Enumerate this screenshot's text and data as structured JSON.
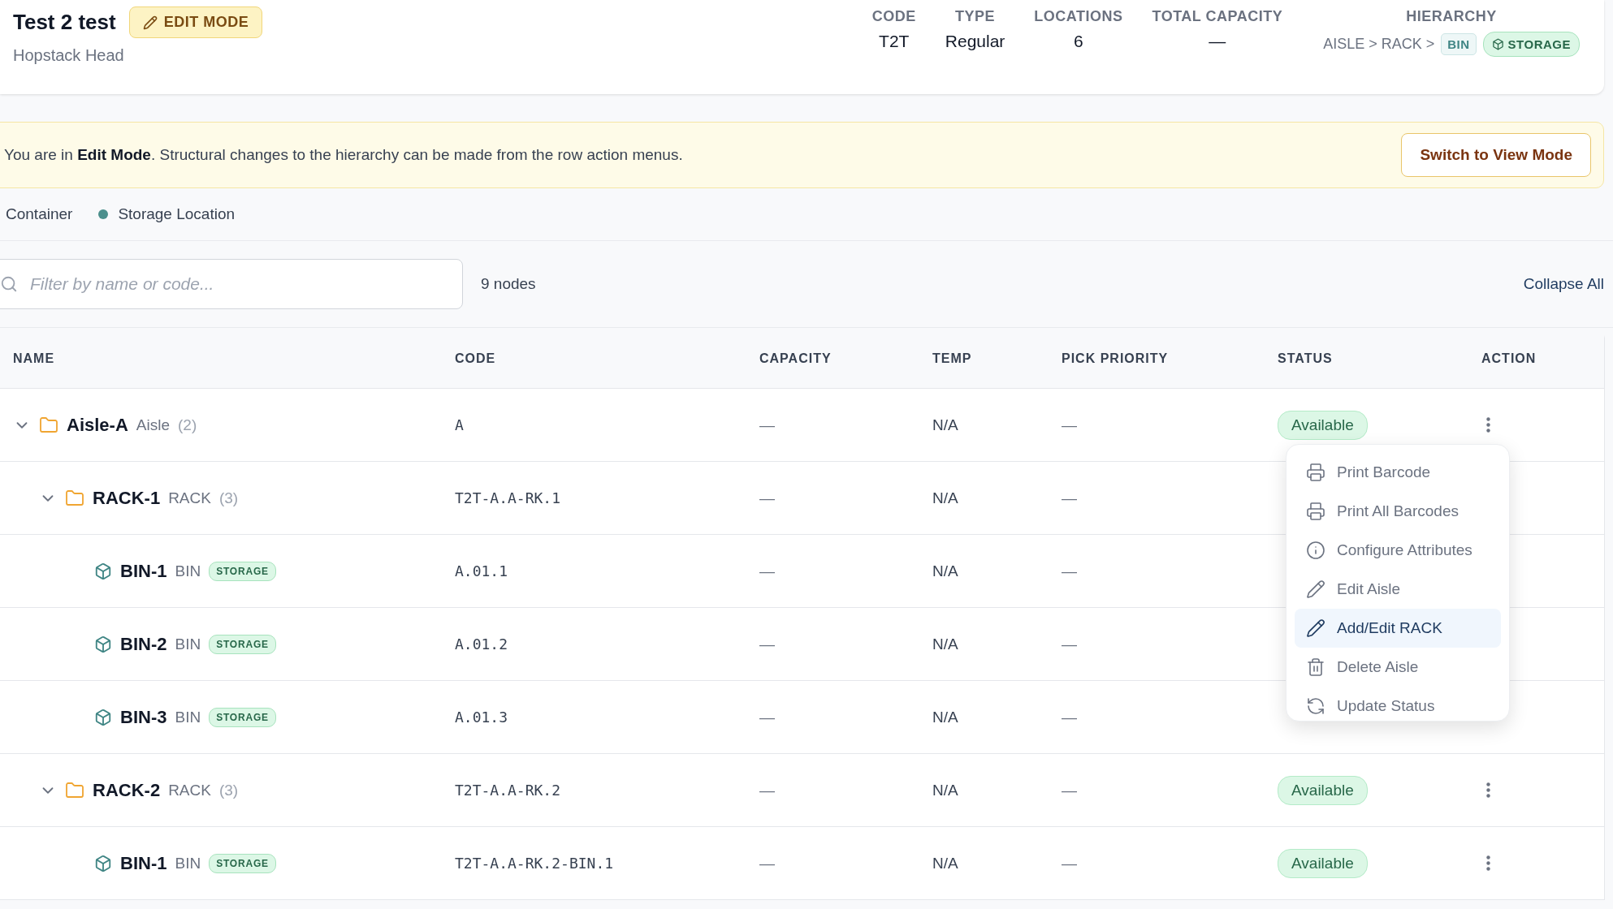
{
  "header": {
    "title": "Test 2 test",
    "mode_badge": "EDIT MODE",
    "subtitle": "Hopstack Head",
    "stats": [
      {
        "label": "CODE",
        "value": "T2T"
      },
      {
        "label": "TYPE",
        "value": "Regular"
      },
      {
        "label": "LOCATIONS",
        "value": "6"
      },
      {
        "label": "TOTAL CAPACITY",
        "value": "—"
      }
    ],
    "hierarchy": {
      "label": "HIERARCHY",
      "path": "AISLE > RACK >",
      "tags": [
        {
          "kind": "plain",
          "text": "BIN"
        },
        {
          "kind": "storage",
          "text": "STORAGE"
        }
      ]
    }
  },
  "banner": {
    "text": "You are in **Edit Mode**. Structural changes to the hierarchy can be made from the row action menus.",
    "button": "Switch to View Mode"
  },
  "legend": [
    {
      "label": "Container"
    },
    {
      "label": "Storage Location",
      "color": "#4b8f8c"
    }
  ],
  "filter": {
    "placeholder": "Filter by name or code...",
    "count": "9 nodes",
    "collapse": "Collapse All"
  },
  "table": {
    "columns": [
      "NAME",
      "CODE",
      "CAPACITY",
      "TEMP",
      "PICK PRIORITY",
      "STATUS",
      "ACTION"
    ],
    "rows": [
      {
        "kind": "container",
        "name": "Aisle-A",
        "type": "Aisle",
        "count": "(2)",
        "expanded": true,
        "code": "A",
        "capacity": "—",
        "temp": "N/A",
        "priority": "—",
        "status": "Available",
        "children": [
          {
            "kind": "container",
            "name": "RACK-1",
            "type": "RACK",
            "count": "(3)",
            "expanded": true,
            "code": "T2T-A.A-RK.1",
            "capacity": "—",
            "temp": "N/A",
            "priority": "—",
            "children": [
              {
                "kind": "storage",
                "name": "BIN-1",
                "type": "BIN",
                "badge": "STORAGE",
                "code": "A.01.1",
                "capacity": "—",
                "temp": "N/A",
                "priority": "—"
              },
              {
                "kind": "storage",
                "name": "BIN-2",
                "type": "BIN",
                "badge": "STORAGE",
                "code": "A.01.2",
                "capacity": "—",
                "temp": "N/A",
                "priority": "—"
              },
              {
                "kind": "storage",
                "name": "BIN-3",
                "type": "BIN",
                "badge": "STORAGE",
                "code": "A.01.3",
                "capacity": "—",
                "temp": "N/A",
                "priority": "—"
              }
            ]
          },
          {
            "kind": "container",
            "name": "RACK-2",
            "type": "RACK",
            "count": "(3)",
            "expanded": true,
            "code": "T2T-A.A-RK.2",
            "capacity": "—",
            "temp": "N/A",
            "priority": "—",
            "status": "Available",
            "children": [
              {
                "kind": "storage",
                "name": "BIN-1",
                "type": "BIN",
                "badge": "STORAGE",
                "code": "T2T-A.A-RK.2-BIN.1",
                "capacity": "—",
                "temp": "N/A",
                "priority": "—",
                "status": "Available"
              }
            ]
          }
        ]
      }
    ]
  },
  "menu": {
    "items": [
      {
        "kind": "print",
        "label": "Print Barcode",
        "selected": false
      },
      {
        "kind": "print",
        "label": "Print All Barcodes",
        "selected": false
      },
      {
        "kind": "info",
        "label": "Configure Attributes",
        "selected": false
      },
      {
        "kind": "edit",
        "label": "Edit Aisle",
        "selected": false
      },
      {
        "kind": "edit",
        "label": "Add/Edit RACK",
        "selected": true
      },
      {
        "kind": "delete",
        "label": "Delete Aisle",
        "selected": false
      },
      {
        "kind": "refresh",
        "label": "Update Status",
        "selected": false
      }
    ]
  }
}
